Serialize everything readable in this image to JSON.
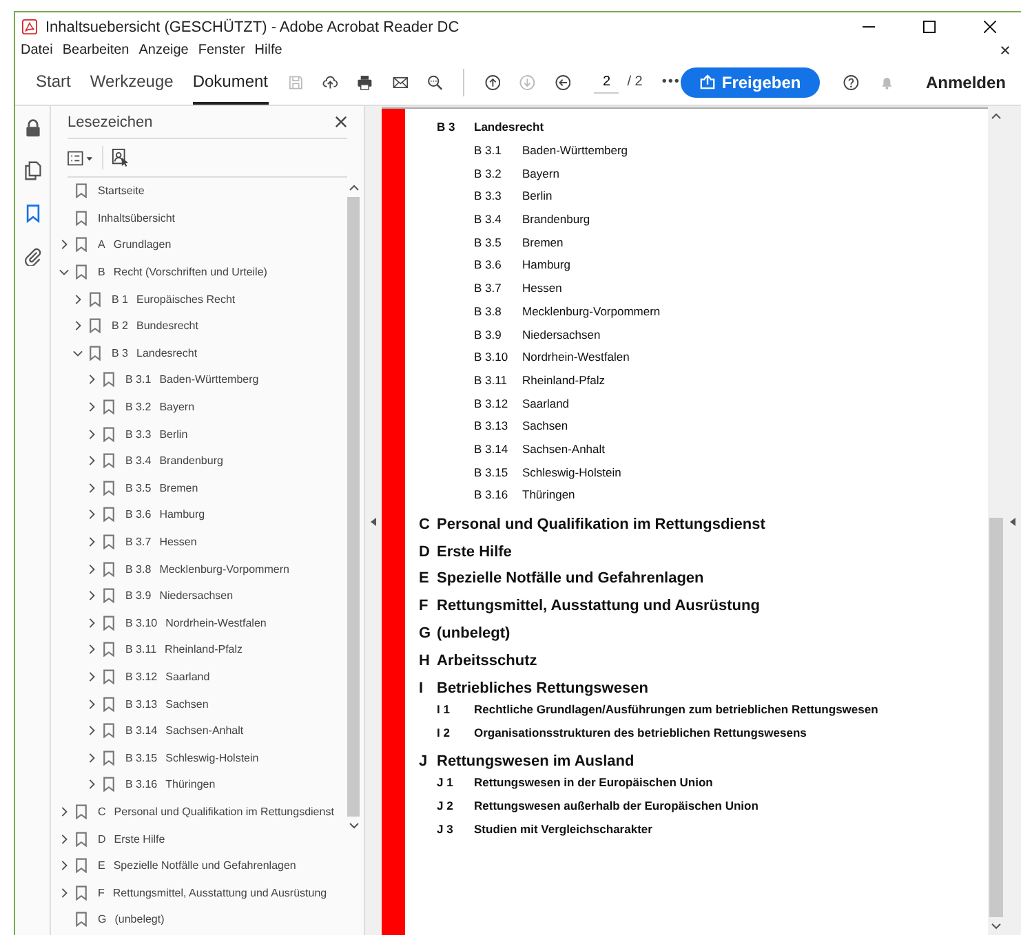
{
  "window": {
    "title": "Inhaltsuebersicht (GESCHÜTZT) - Adobe Acrobat Reader DC"
  },
  "menu": [
    "Datei",
    "Bearbeiten",
    "Anzeige",
    "Fenster",
    "Hilfe"
  ],
  "tabs": [
    {
      "label": "Start",
      "selected": false
    },
    {
      "label": "Werkzeuge",
      "selected": false
    },
    {
      "label": "Dokument",
      "selected": true
    }
  ],
  "page_field": {
    "value": "2"
  },
  "page_total": "/ 2",
  "more": "•••",
  "share_button": "Freigeben",
  "sign_in": "Anmelden",
  "side_tools": [
    {
      "selected": false
    },
    {
      "selected": false
    },
    {
      "selected": true
    },
    {
      "selected": false
    }
  ],
  "bookmarks": {
    "title": "Lesezeichen",
    "items": [
      {
        "title": "Startseite"
      },
      {
        "title": "Inhaltsübersicht"
      },
      {
        "number": "A",
        "title": "Grundlagen",
        "expanded": false
      },
      {
        "number": "B",
        "title": "Recht (Vorschriften und Urteile)",
        "expanded": true,
        "children": [
          {
            "number": "B 1",
            "title": "Europäisches Recht",
            "expanded": false
          },
          {
            "number": "B 2",
            "title": "Bundesrecht",
            "expanded": false
          },
          {
            "number": "B 3",
            "title": "Landesrecht",
            "expanded": true,
            "children": [
              {
                "number": "B 3.1",
                "title": "Baden-Württemberg",
                "expanded": false
              },
              {
                "number": "B 3.2",
                "title": "Bayern",
                "expanded": false
              },
              {
                "number": "B 3.3",
                "title": "Berlin",
                "expanded": false
              },
              {
                "number": "B 3.4",
                "title": "Brandenburg",
                "expanded": false
              },
              {
                "number": "B 3.5",
                "title": "Bremen",
                "expanded": false
              },
              {
                "number": "B 3.6",
                "title": "Hamburg",
                "expanded": false
              },
              {
                "number": "B 3.7",
                "title": "Hessen",
                "expanded": false
              },
              {
                "number": "B 3.8",
                "title": "Mecklenburg-Vorpommern",
                "expanded": false
              },
              {
                "number": "B 3.9",
                "title": "Niedersachsen",
                "expanded": false
              },
              {
                "number": "B 3.10",
                "title": "Nordrhein-Westfalen",
                "expanded": false
              },
              {
                "number": "B 3.11",
                "title": "Rheinland-Pfalz",
                "expanded": false
              },
              {
                "number": "B 3.12",
                "title": "Saarland",
                "expanded": false
              },
              {
                "number": "B 3.13",
                "title": "Sachsen",
                "expanded": false
              },
              {
                "number": "B 3.14",
                "title": "Sachsen-Anhalt",
                "expanded": false
              },
              {
                "number": "B 3.15",
                "title": "Schleswig-Holstein",
                "expanded": false
              },
              {
                "number": "B 3.16",
                "title": "Thüringen",
                "expanded": false
              }
            ]
          }
        ]
      },
      {
        "number": "C",
        "title": "Personal und Qualifikation im Rettungsdienst",
        "expanded": false
      },
      {
        "number": "D",
        "title": "Erste Hilfe",
        "expanded": false
      },
      {
        "number": "E",
        "title": "Spezielle Notfälle und Gefahrenlagen",
        "expanded": false
      },
      {
        "number": "F",
        "title": "Rettungsmittel, Ausstattung und Ausrüstung",
        "expanded": false
      },
      {
        "number": "G",
        "title": "(unbelegt)"
      }
    ]
  },
  "document": {
    "entries": [
      {
        "kind": "sub",
        "number": "B 3",
        "title": "Landesrecht"
      },
      {
        "kind": "subsub",
        "number": "B 3.1",
        "title": "Baden-Württemberg"
      },
      {
        "kind": "subsub",
        "number": "B 3.2",
        "title": "Bayern"
      },
      {
        "kind": "subsub",
        "number": "B 3.3",
        "title": "Berlin"
      },
      {
        "kind": "subsub",
        "number": "B 3.4",
        "title": "Brandenburg"
      },
      {
        "kind": "subsub",
        "number": "B 3.5",
        "title": "Bremen"
      },
      {
        "kind": "subsub",
        "number": "B 3.6",
        "title": "Hamburg"
      },
      {
        "kind": "subsub",
        "number": "B 3.7",
        "title": "Hessen"
      },
      {
        "kind": "subsub",
        "number": "B 3.8",
        "title": "Mecklenburg-Vorpommern"
      },
      {
        "kind": "subsub",
        "number": "B 3.9",
        "title": "Niedersachsen"
      },
      {
        "kind": "subsub",
        "number": "B 3.10",
        "title": "Nordrhein-Westfalen"
      },
      {
        "kind": "subsub",
        "number": "B 3.11",
        "title": "Rheinland-Pfalz"
      },
      {
        "kind": "subsub",
        "number": "B 3.12",
        "title": "Saarland"
      },
      {
        "kind": "subsub",
        "number": "B 3.13",
        "title": "Sachsen"
      },
      {
        "kind": "subsub",
        "number": "B 3.14",
        "title": "Sachsen-Anhalt"
      },
      {
        "kind": "subsub",
        "number": "B 3.15",
        "title": "Schleswig-Holstein"
      },
      {
        "kind": "subsub",
        "number": "B 3.16",
        "title": "Thüringen"
      },
      {
        "kind": "section",
        "number": "C",
        "title": "Personal und Qualifikation im Rettungsdienst"
      },
      {
        "kind": "section",
        "number": "D",
        "title": "Erste Hilfe"
      },
      {
        "kind": "section",
        "number": "E",
        "title": "Spezielle Notfälle und Gefahrenlagen"
      },
      {
        "kind": "section",
        "number": "F",
        "title": "Rettungsmittel, Ausstattung und Ausrüstung"
      },
      {
        "kind": "section",
        "number": "G",
        "title": "(unbelegt)"
      },
      {
        "kind": "section",
        "number": "H",
        "title": "Arbeitsschutz"
      },
      {
        "kind": "section",
        "number": "I",
        "title": "Betriebliches Rettungswesen"
      },
      {
        "kind": "sub",
        "number": "I 1",
        "title": "Rechtliche Grundlagen/Ausführungen zum betrieblichen Rettungswesen"
      },
      {
        "kind": "sub",
        "number": "I 2",
        "title": "Organisationsstrukturen des betrieblichen Rettungswesens"
      },
      {
        "kind": "section",
        "number": "J",
        "title": "Rettungswesen im Ausland"
      },
      {
        "kind": "sub",
        "number": "J 1",
        "title": "Rettungswesen in der Europäischen Union"
      },
      {
        "kind": "sub",
        "number": "J 2",
        "title": "Rettungswesen außerhalb der Europäischen Union"
      },
      {
        "kind": "sub",
        "number": "J 3",
        "title": "Studien mit Vergleichscharakter"
      }
    ]
  }
}
